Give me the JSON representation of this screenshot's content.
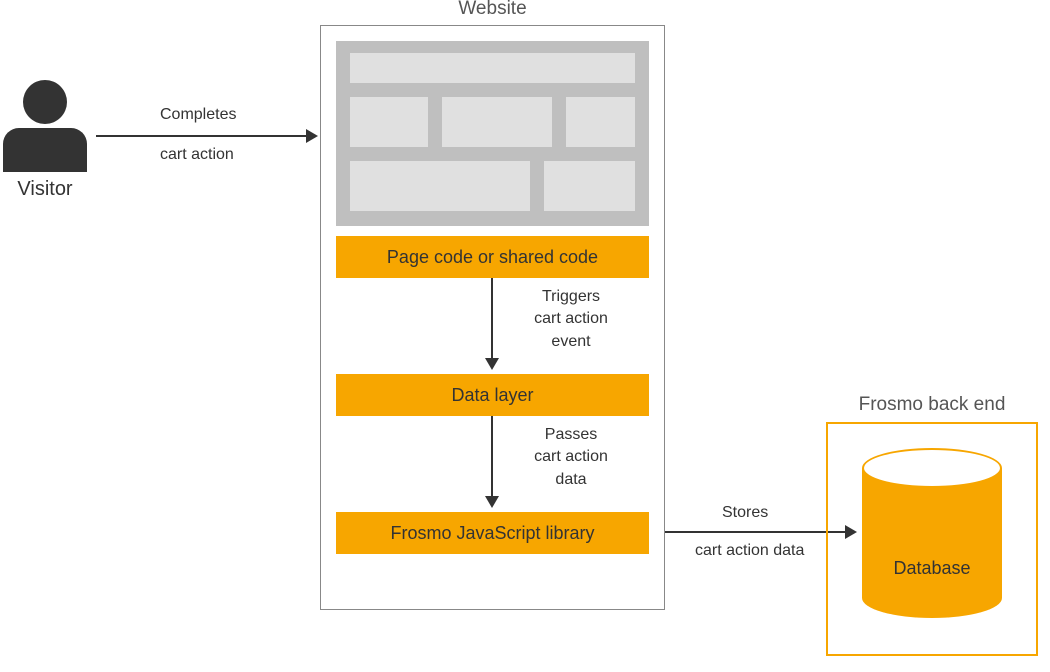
{
  "visitor": {
    "label": "Visitor"
  },
  "website": {
    "title": "Website",
    "page_code_box": "Page code or shared code",
    "data_layer_box": "Data layer",
    "js_library_box": "Frosmo JavaScript library"
  },
  "backend": {
    "title": "Frosmo back end",
    "database_label": "Database"
  },
  "arrows": {
    "completes": {
      "line1": "Completes",
      "line2": "cart action"
    },
    "triggers": {
      "line1": "Triggers",
      "line2": "cart action",
      "line3": "event"
    },
    "passes": {
      "line1": "Passes",
      "line2": "cart action",
      "line3": "data"
    },
    "stores": {
      "line1": "Stores",
      "line2": "cart action data"
    }
  }
}
